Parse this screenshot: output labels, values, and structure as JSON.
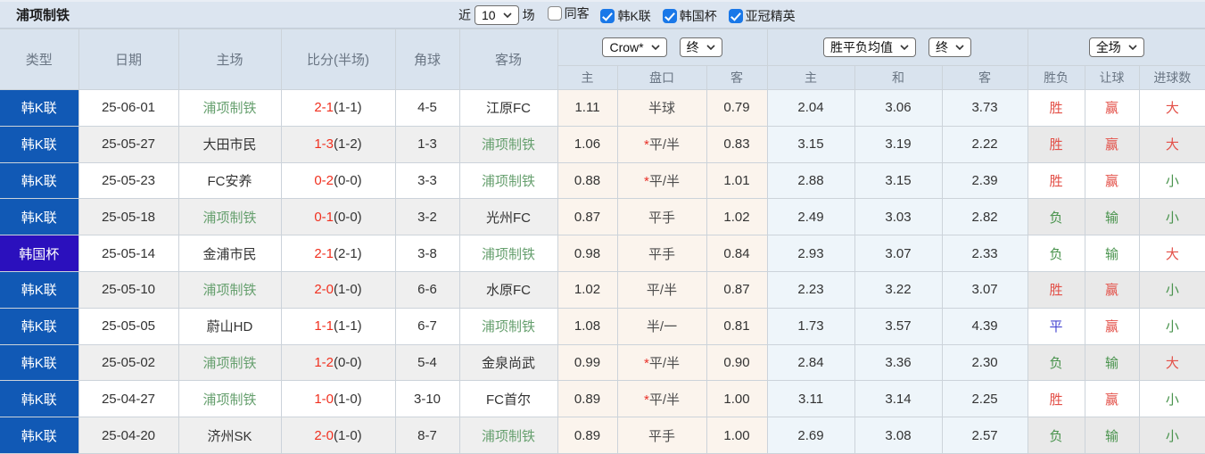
{
  "colors": {
    "league_blue": "#1159b5",
    "cup_indigo": "#2b10bd",
    "win_red": "#e35048",
    "lose_green": "#49934d",
    "draw_blue": "#4747d1",
    "score_red": "#f0301f",
    "team_self_green": "#67a06f",
    "checkbox_blue": "#1a78e8",
    "header_bg": "#d9e3ee",
    "crown_col_bg": "#fbf4ed",
    "avg_col_bg": "#eef5fa"
  },
  "header_bar": {
    "title": "浦项制铁",
    "near_label": "近",
    "matches_count": "10",
    "games_label": "场",
    "filters": [
      {
        "label": "同客",
        "checked": false
      },
      {
        "label": "韩K联",
        "checked": true
      },
      {
        "label": "韩国杯",
        "checked": true
      },
      {
        "label": "亚冠精英",
        "checked": true
      }
    ]
  },
  "table": {
    "headers": {
      "type": "类型",
      "date": "日期",
      "home": "主场",
      "score": "比分(半场)",
      "corner": "角球",
      "away": "客场",
      "crown_select": "Crow*",
      "crown_final_select": "终",
      "crown_sub_home": "主",
      "crown_sub_handicap": "盘口",
      "crown_sub_away": "客",
      "avg_select": "胜平负均值",
      "avg_final_select": "终",
      "avg_sub_home": "主",
      "avg_sub_draw": "和",
      "avg_sub_away": "客",
      "full_select": "全场",
      "result_sub_wl": "胜负",
      "result_sub_handicap": "让球",
      "result_sub_goals": "进球数"
    },
    "rows": [
      {
        "type": "韩K联",
        "type_style": "league",
        "date": "25-06-01",
        "home": "浦项制铁",
        "home_self": true,
        "score": "2-1",
        "half": "(1-1)",
        "corner": "4-5",
        "away": "江原FC",
        "away_self": false,
        "crown_home": "1.11",
        "handicap_star": "",
        "handicap": "半球",
        "crown_away": "0.79",
        "avg_home": "2.04",
        "avg_draw": "3.06",
        "avg_away": "3.73",
        "result": "胜",
        "result_color": "red",
        "let_result": "赢",
        "let_color": "red",
        "goals": "大",
        "goals_color": "red"
      },
      {
        "type": "韩K联",
        "type_style": "league",
        "date": "25-05-27",
        "home": "大田市民",
        "home_self": false,
        "score": "1-3",
        "half": "(1-2)",
        "corner": "1-3",
        "away": "浦项制铁",
        "away_self": true,
        "crown_home": "1.06",
        "handicap_star": "*",
        "handicap": "平/半",
        "crown_away": "0.83",
        "avg_home": "3.15",
        "avg_draw": "3.19",
        "avg_away": "2.22",
        "result": "胜",
        "result_color": "red",
        "let_result": "赢",
        "let_color": "red",
        "goals": "大",
        "goals_color": "red"
      },
      {
        "type": "韩K联",
        "type_style": "league",
        "date": "25-05-23",
        "home": "FC安养",
        "home_self": false,
        "score": "0-2",
        "half": "(0-0)",
        "corner": "3-3",
        "away": "浦项制铁",
        "away_self": true,
        "crown_home": "0.88",
        "handicap_star": "*",
        "handicap": "平/半",
        "crown_away": "1.01",
        "avg_home": "2.88",
        "avg_draw": "3.15",
        "avg_away": "2.39",
        "result": "胜",
        "result_color": "red",
        "let_result": "赢",
        "let_color": "red",
        "goals": "小",
        "goals_color": "green"
      },
      {
        "type": "韩K联",
        "type_style": "league",
        "date": "25-05-18",
        "home": "浦项制铁",
        "home_self": true,
        "score": "0-1",
        "half": "(0-0)",
        "corner": "3-2",
        "away": "光州FC",
        "away_self": false,
        "crown_home": "0.87",
        "handicap_star": "",
        "handicap": "平手",
        "crown_away": "1.02",
        "avg_home": "2.49",
        "avg_draw": "3.03",
        "avg_away": "2.82",
        "result": "负",
        "result_color": "green",
        "let_result": "输",
        "let_color": "green",
        "goals": "小",
        "goals_color": "green"
      },
      {
        "type": "韩国杯",
        "type_style": "cup",
        "date": "25-05-14",
        "home": "金浦市民",
        "home_self": false,
        "score": "2-1",
        "half": "(2-1)",
        "corner": "3-8",
        "away": "浦项制铁",
        "away_self": true,
        "crown_home": "0.98",
        "handicap_star": "",
        "handicap": "平手",
        "crown_away": "0.84",
        "avg_home": "2.93",
        "avg_draw": "3.07",
        "avg_away": "2.33",
        "result": "负",
        "result_color": "green",
        "let_result": "输",
        "let_color": "green",
        "goals": "大",
        "goals_color": "red"
      },
      {
        "type": "韩K联",
        "type_style": "league",
        "date": "25-05-10",
        "home": "浦项制铁",
        "home_self": true,
        "score": "2-0",
        "half": "(1-0)",
        "corner": "6-6",
        "away": "水原FC",
        "away_self": false,
        "crown_home": "1.02",
        "handicap_star": "",
        "handicap": "平/半",
        "crown_away": "0.87",
        "avg_home": "2.23",
        "avg_draw": "3.22",
        "avg_away": "3.07",
        "result": "胜",
        "result_color": "red",
        "let_result": "赢",
        "let_color": "red",
        "goals": "小",
        "goals_color": "green"
      },
      {
        "type": "韩K联",
        "type_style": "league",
        "date": "25-05-05",
        "home": "蔚山HD",
        "home_self": false,
        "score": "1-1",
        "half": "(1-1)",
        "corner": "6-7",
        "away": "浦项制铁",
        "away_self": true,
        "crown_home": "1.08",
        "handicap_star": "",
        "handicap": "半/一",
        "crown_away": "0.81",
        "avg_home": "1.73",
        "avg_draw": "3.57",
        "avg_away": "4.39",
        "result": "平",
        "result_color": "blue",
        "let_result": "赢",
        "let_color": "red",
        "goals": "小",
        "goals_color": "green"
      },
      {
        "type": "韩K联",
        "type_style": "league",
        "date": "25-05-02",
        "home": "浦项制铁",
        "home_self": true,
        "score": "1-2",
        "half": "(0-0)",
        "corner": "5-4",
        "away": "金泉尚武",
        "away_self": false,
        "crown_home": "0.99",
        "handicap_star": "*",
        "handicap": "平/半",
        "crown_away": "0.90",
        "avg_home": "2.84",
        "avg_draw": "3.36",
        "avg_away": "2.30",
        "result": "负",
        "result_color": "green",
        "let_result": "输",
        "let_color": "green",
        "goals": "大",
        "goals_color": "red"
      },
      {
        "type": "韩K联",
        "type_style": "league",
        "date": "25-04-27",
        "home": "浦项制铁",
        "home_self": true,
        "score": "1-0",
        "half": "(1-0)",
        "corner": "3-10",
        "away": "FC首尔",
        "away_self": false,
        "crown_home": "0.89",
        "handicap_star": "*",
        "handicap": "平/半",
        "crown_away": "1.00",
        "avg_home": "3.11",
        "avg_draw": "3.14",
        "avg_away": "2.25",
        "result": "胜",
        "result_color": "red",
        "let_result": "赢",
        "let_color": "red",
        "goals": "小",
        "goals_color": "green"
      },
      {
        "type": "韩K联",
        "type_style": "league",
        "date": "25-04-20",
        "home": "济州SK",
        "home_self": false,
        "score": "2-0",
        "half": "(1-0)",
        "corner": "8-7",
        "away": "浦项制铁",
        "away_self": true,
        "crown_home": "0.89",
        "handicap_star": "",
        "handicap": "平手",
        "crown_away": "1.00",
        "avg_home": "2.69",
        "avg_draw": "3.08",
        "avg_away": "2.57",
        "result": "负",
        "result_color": "green",
        "let_result": "输",
        "let_color": "green",
        "goals": "小",
        "goals_color": "green"
      }
    ]
  }
}
